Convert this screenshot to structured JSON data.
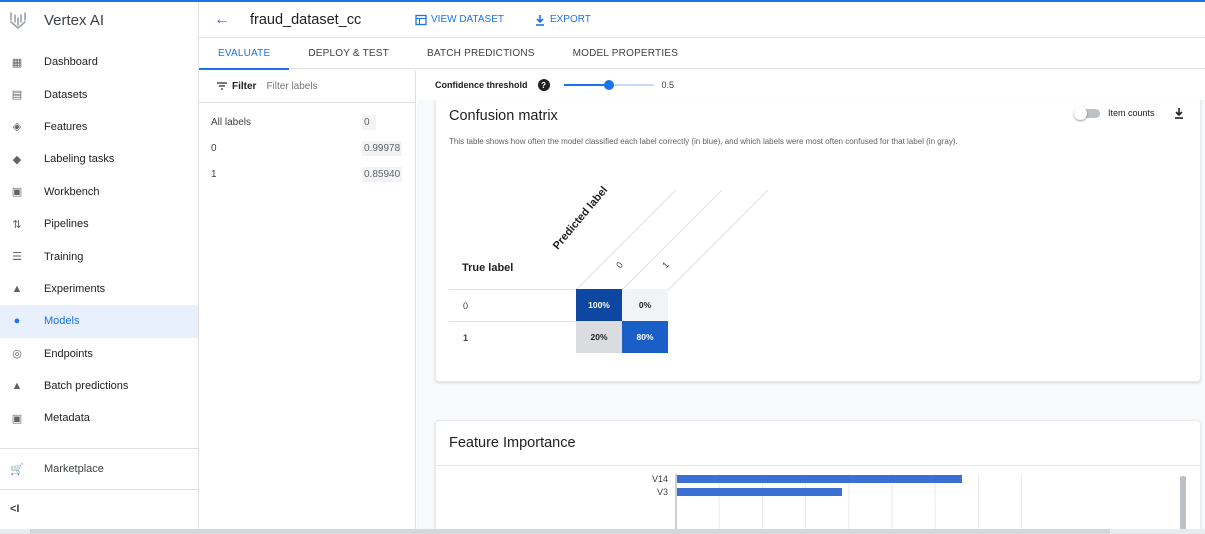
{
  "app": {
    "brand": "Vertex AI"
  },
  "nav": {
    "items": [
      {
        "label": "Dashboard",
        "icon": "dashboard-icon"
      },
      {
        "label": "Datasets",
        "icon": "datasets-icon"
      },
      {
        "label": "Features",
        "icon": "features-icon"
      },
      {
        "label": "Labeling tasks",
        "icon": "label-icon"
      },
      {
        "label": "Workbench",
        "icon": "workbench-icon"
      },
      {
        "label": "Pipelines",
        "icon": "pipelines-icon"
      },
      {
        "label": "Training",
        "icon": "training-icon"
      },
      {
        "label": "Experiments",
        "icon": "experiments-icon"
      },
      {
        "label": "Models",
        "icon": "models-icon"
      },
      {
        "label": "Endpoints",
        "icon": "endpoints-icon"
      },
      {
        "label": "Batch predictions",
        "icon": "batch-icon"
      },
      {
        "label": "Metadata",
        "icon": "metadata-icon"
      }
    ],
    "marketplace": "Marketplace",
    "collapse": "<I"
  },
  "header": {
    "title": "fraud_dataset_cc",
    "view_dataset": "VIEW DATASET",
    "export": "EXPORT"
  },
  "tabs": [
    "EVALUATE",
    "DEPLOY & TEST",
    "BATCH PREDICTIONS",
    "MODEL PROPERTIES"
  ],
  "filter": {
    "label": "Filter",
    "placeholder": "Filter labels"
  },
  "labels": [
    {
      "name": "All labels",
      "value": "0"
    },
    {
      "name": "0",
      "value": "0.99978"
    },
    {
      "name": "1",
      "value": "0.85940"
    }
  ],
  "confidence": {
    "label": "Confidence threshold",
    "help": "?",
    "value": "0.5",
    "fraction": 0.5
  },
  "confusion": {
    "title": "Confusion matrix",
    "description": "This table shows how often the model classified each label correctly (in blue), and which labels were most often confused for that label (in gray).",
    "item_counts": "Item counts",
    "true_label": "True label",
    "predicted_label": "Predicted label",
    "columns": [
      "0",
      "1"
    ],
    "rows": [
      {
        "label": "0",
        "cells": [
          "100%",
          "0%"
        ]
      },
      {
        "label": "1",
        "cells": [
          "20%",
          "80%"
        ]
      }
    ],
    "colors": {
      "strong_blue": "#0d47a1",
      "blue": "#1a5fc7",
      "gray": "#e0e0e0",
      "light": "#f1f3f4"
    }
  },
  "feature_importance": {
    "title": "Feature Importance"
  },
  "chart_data": {
    "type": "bar",
    "categories": [
      "V14",
      "V3"
    ],
    "values": [
      0.95,
      0.55
    ],
    "title": "",
    "xlabel": "",
    "ylabel": "",
    "grid": true
  }
}
